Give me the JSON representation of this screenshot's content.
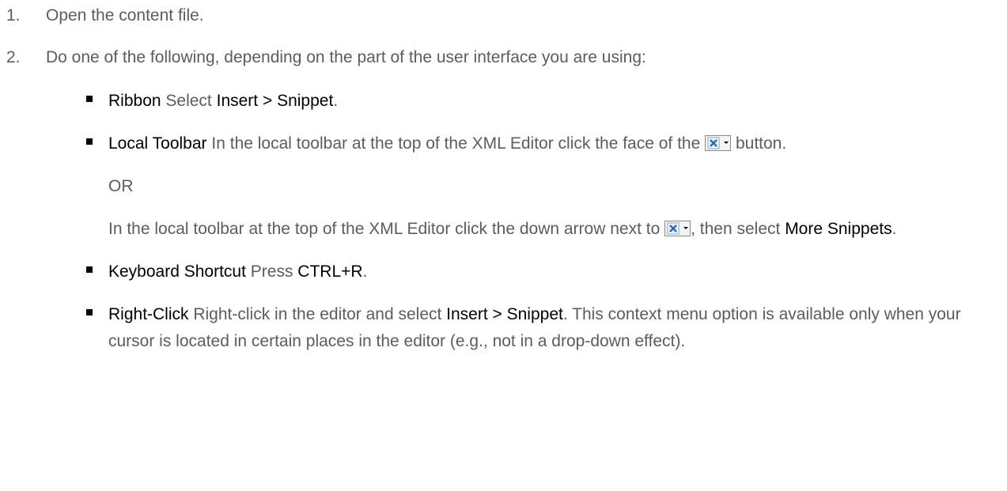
{
  "steps": [
    {
      "num": "1.",
      "text": "Open the content file."
    },
    {
      "num": "2.",
      "text": "Do one of the following, depending on the part of the user interface you are using:"
    }
  ],
  "ribbon": {
    "term": "Ribbon",
    "t1": " Select ",
    "ui": "Insert > Snippet",
    "t2": "."
  },
  "local_toolbar": {
    "term": "Local Toolbar",
    "p1_text": " In the local toolbar at the top of the XML Editor click the face of the ",
    "p1_end": " button.",
    "or": "OR",
    "p2_text": "In the local toolbar at the top of the XML Editor click the down arrow next to ",
    "p2_mid": ", then select ",
    "p2_ui": "More Snippets",
    "p2_end": "."
  },
  "keyboard": {
    "term": "Keyboard Shortcut",
    "t1": " Press ",
    "ui": "CTRL+R",
    "t2": "."
  },
  "right_click": {
    "term": "Right-Click",
    "t1": " Right-click in the editor and select ",
    "ui": "Insert > Snippet",
    "t2": ". This context menu option is available only when your cursor is located in certain places in the editor (e.g., not in a drop-down effect)."
  },
  "icons": {
    "snippet_button": "insert-snippet-icon",
    "bullet": "square-bullet"
  },
  "colors": {
    "body_text": "#5c5c5c",
    "emphasis_text": "#000000"
  }
}
